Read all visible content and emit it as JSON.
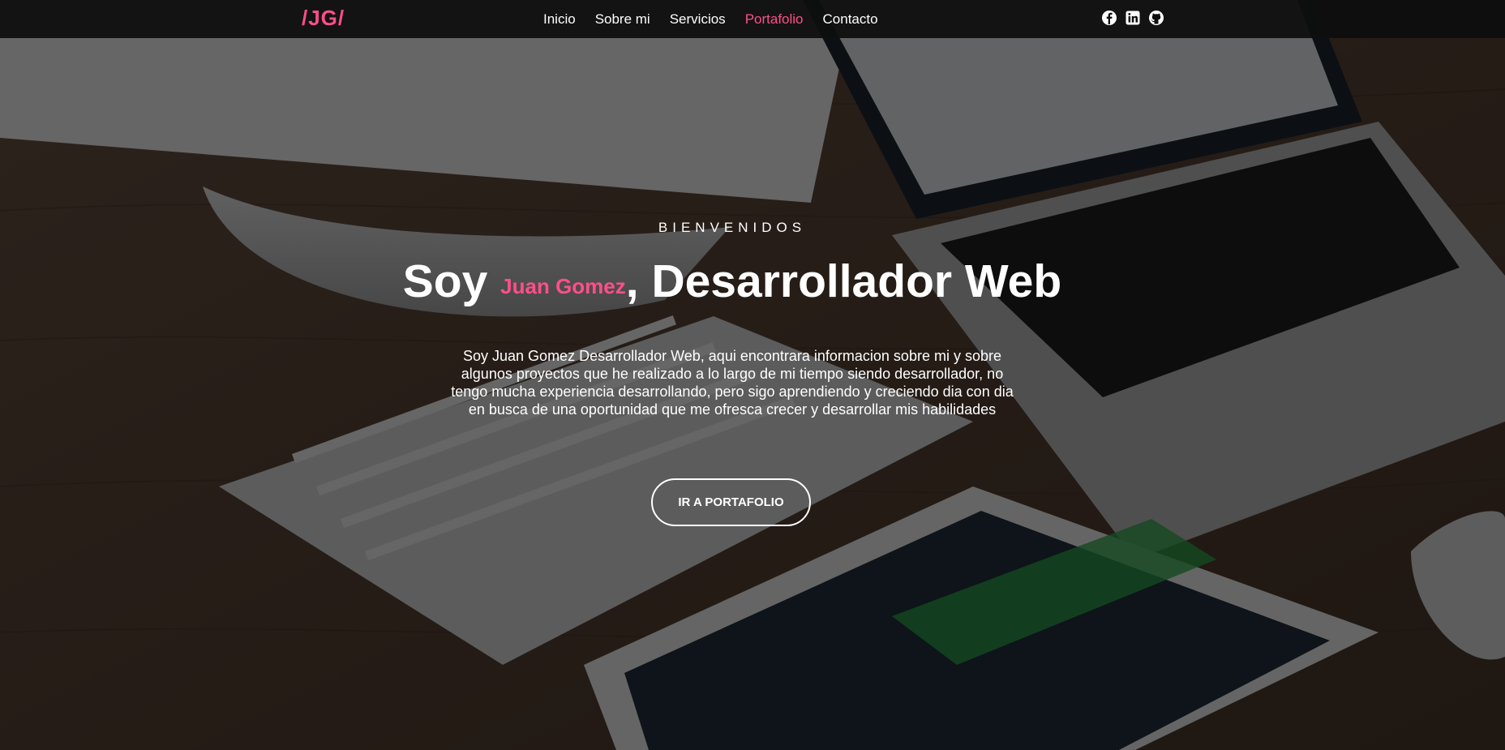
{
  "colors": {
    "accent": "#ff4f8a",
    "navbar_bg": "#0e0e0e",
    "text": "#ffffff"
  },
  "nav": {
    "logo": "/JG/",
    "links": [
      {
        "label": "Inicio",
        "active": false
      },
      {
        "label": "Sobre mi",
        "active": false
      },
      {
        "label": "Servicios",
        "active": false
      },
      {
        "label": "Portafolio",
        "active": true
      },
      {
        "label": "Contacto",
        "active": false
      }
    ],
    "socials": [
      "facebook-icon",
      "linkedin-icon",
      "github-icon"
    ]
  },
  "hero": {
    "kicker": "BIENVENIDOS",
    "title_prefix": "Soy",
    "name": "Juan Gomez",
    "title_suffix": ", Desarrollador Web",
    "description": "Soy Juan Gomez Desarrollador Web, aqui encontrara informacion sobre mi y sobre algunos proyectos que he realizado a lo largo de mi tiempo siendo desarrollador, no tengo mucha experiencia desarrollando, pero sigo aprendiendo y creciendo dia con dia en busca de una oportunidad que me ofresca crecer y desarrollar mis habilidades",
    "button_label": "IR A PORTAFOLIO"
  }
}
